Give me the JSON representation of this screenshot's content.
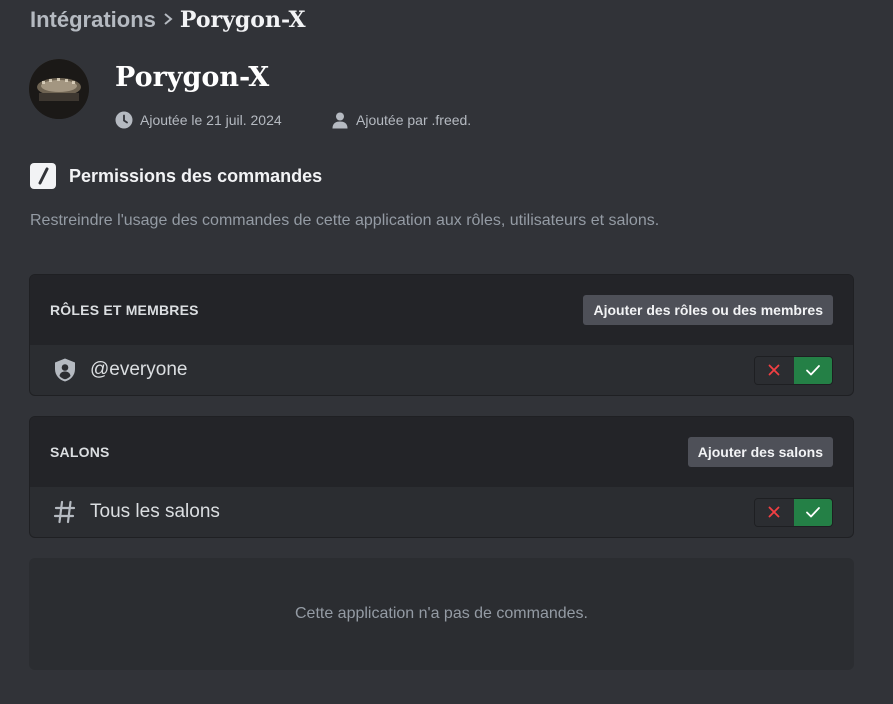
{
  "breadcrumb": {
    "parent": "Intégrations",
    "separator": ">",
    "current": "Porygon-X"
  },
  "app": {
    "name": "Porygon-X",
    "added_date": "Ajoutée le 21 juil. 2024",
    "added_by": "Ajoutée par .freed."
  },
  "command_permissions": {
    "title": "Permissions des commandes",
    "description": "Restreindre l'usage des commandes de cette application aux rôles, utilisateurs et salons."
  },
  "roles_panel": {
    "title": "RÔLES ET MEMBRES",
    "add_button": "Ajouter des rôles ou des membres",
    "rows": [
      {
        "label": "@everyone",
        "icon": "shield-icon",
        "state": "allowed"
      }
    ]
  },
  "channels_panel": {
    "title": "SALONS",
    "add_button": "Ajouter des salons",
    "rows": [
      {
        "label": "Tous les salons",
        "icon": "hashtag-icon",
        "state": "allowed"
      }
    ]
  },
  "empty_state": {
    "text": "Cette application n'a pas de commandes."
  },
  "colors": {
    "background": "#313338",
    "panel": "#2b2d31",
    "panel_header": "#232428",
    "allow_green": "#248046",
    "deny_red": "#f23f43",
    "button_secondary": "#4e5058"
  }
}
